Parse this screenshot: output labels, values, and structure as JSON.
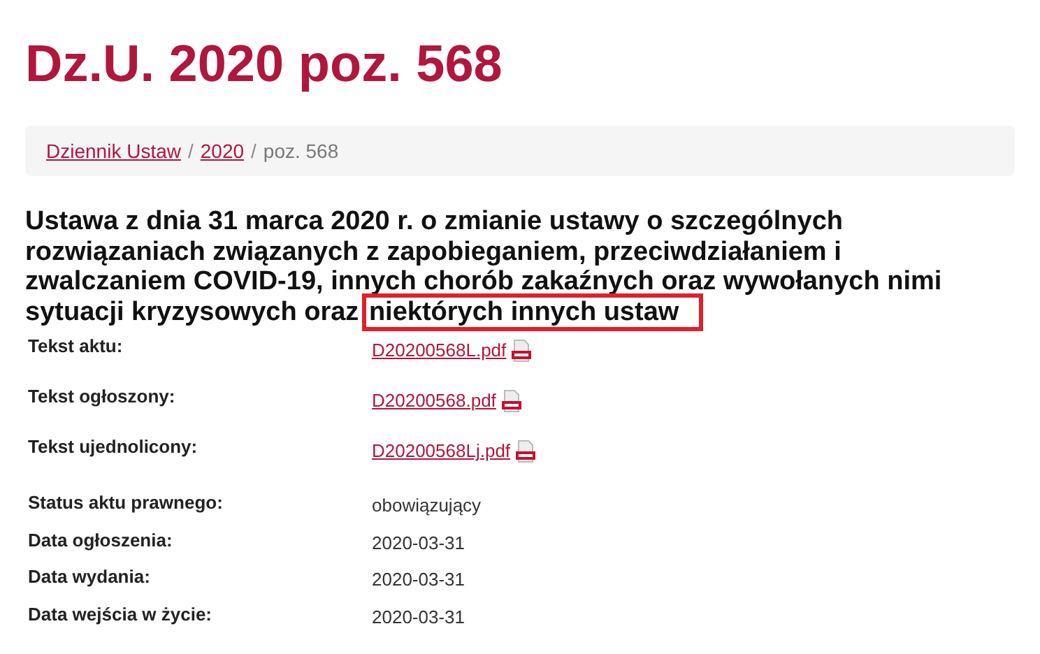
{
  "page_title": "Dz.U. 2020 poz. 568",
  "breadcrumb_separator": "/",
  "breadcrumb": [
    {
      "label": "Dziennik Ustaw",
      "kind": "link"
    },
    {
      "label": "2020",
      "kind": "link"
    },
    {
      "label": "poz. 568",
      "kind": "current"
    }
  ],
  "act_title": {
    "text": "Ustawa z dnia 31 marca 2020 r. o zmianie ustawy o szczególnych rozwiązaniach związanych z zapobieganiem, przeciwdziałaniem i zwalczaniem COVID-19, innych chorób zakaźnych oraz wywołanych nimi sytuacji kryzysowych oraz ",
    "highlighted": "niektórych innych ustaw"
  },
  "details": [
    {
      "label": "Tekst aktu:",
      "value": "D20200568L.pdf",
      "kind": "file"
    },
    {
      "label": "Tekst ogłoszony:",
      "value": "D20200568.pdf",
      "kind": "file"
    },
    {
      "label": "Tekst ujednolicony:",
      "value": "D20200568Lj.pdf",
      "kind": "file"
    },
    {
      "label": "Status aktu prawnego:",
      "value": "obowiązujący",
      "kind": "text"
    },
    {
      "label": "Data ogłoszenia:",
      "value": "2020-03-31",
      "kind": "text"
    },
    {
      "label": "Data wydania:",
      "value": "2020-03-31",
      "kind": "text"
    },
    {
      "label": "Data wejścia w życie:",
      "value": "2020-03-31",
      "kind": "text"
    }
  ]
}
